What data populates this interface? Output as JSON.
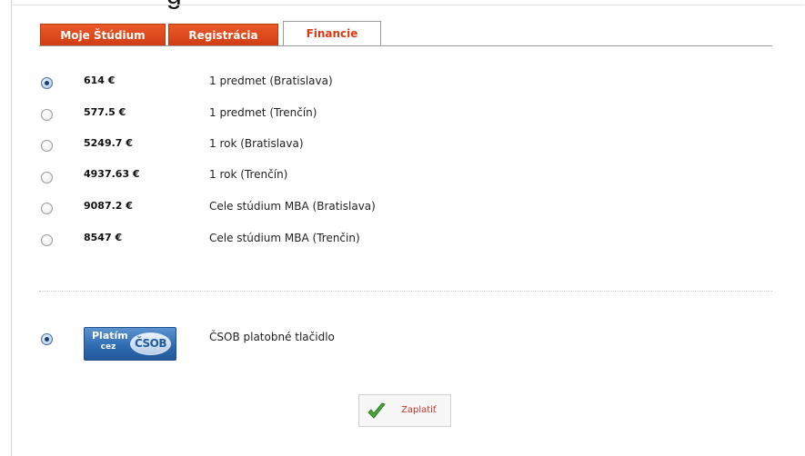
{
  "top_fragment": "g",
  "tabs": [
    {
      "label": "Moje Štúdium",
      "active": false
    },
    {
      "label": "Registrácia",
      "active": false
    },
    {
      "label": "Financie",
      "active": true
    }
  ],
  "options": [
    {
      "price": "614 €",
      "label": "1 predmet (Bratislava)",
      "checked": true
    },
    {
      "price": "577.5 €",
      "label": "1 predmet (Trenčín)",
      "checked": false
    },
    {
      "price": "5249.7 €",
      "label": "1 rok (Bratislava)",
      "checked": false
    },
    {
      "price": "4937.63 €",
      "label": "1 rok (Trenčín)",
      "checked": false
    },
    {
      "price": "9087.2 €",
      "label": "Cele stúdium MBA (Bratislava)",
      "checked": false
    },
    {
      "price": "8547 €",
      "label": "Cele stúdium MBA (Trenčin)",
      "checked": false
    }
  ],
  "payment": {
    "logo_line1": "Platím",
    "logo_line2": "cez",
    "logo_brand": "ČSOB",
    "label": "ČSOB platobné tlačidlo",
    "checked": true
  },
  "pay_button": {
    "label": "Zaplatiť",
    "icon": "checkmark-icon"
  },
  "colors": {
    "tab_red": "#d9471a",
    "active_tab_text": "#d83a14",
    "logo_blue": "#2f6cb3",
    "check_green": "#4aa436"
  }
}
